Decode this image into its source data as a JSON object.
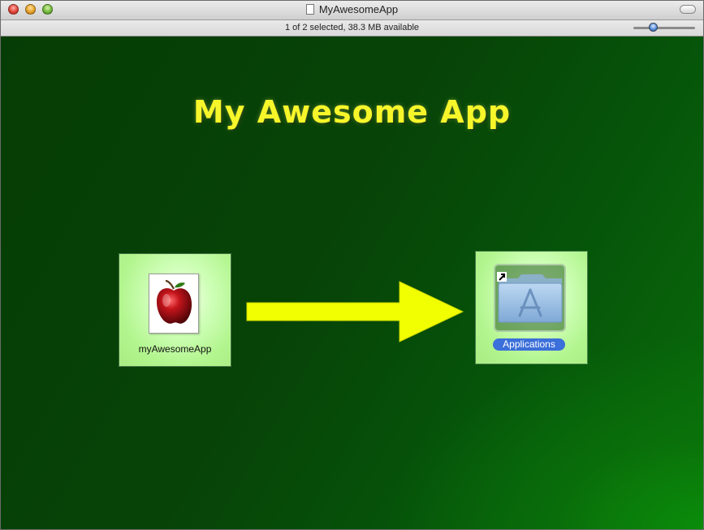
{
  "window": {
    "title": "MyAwesomeApp"
  },
  "statusbar": {
    "text": "1 of 2 selected, 38.3 MB available"
  },
  "content": {
    "heading": "My Awesome App",
    "app_item": {
      "label": "myAwesomeApp",
      "icon": "apple-icon"
    },
    "applications_item": {
      "label": "Applications",
      "icon": "applications-folder-icon"
    },
    "arrow_icon": "right-arrow-icon"
  },
  "colors": {
    "background": "#0a3a06",
    "heading": "#f6f62a",
    "arrow": "#f2ff00",
    "selection": "#3b6fd9",
    "tile": "#b2f58e"
  }
}
